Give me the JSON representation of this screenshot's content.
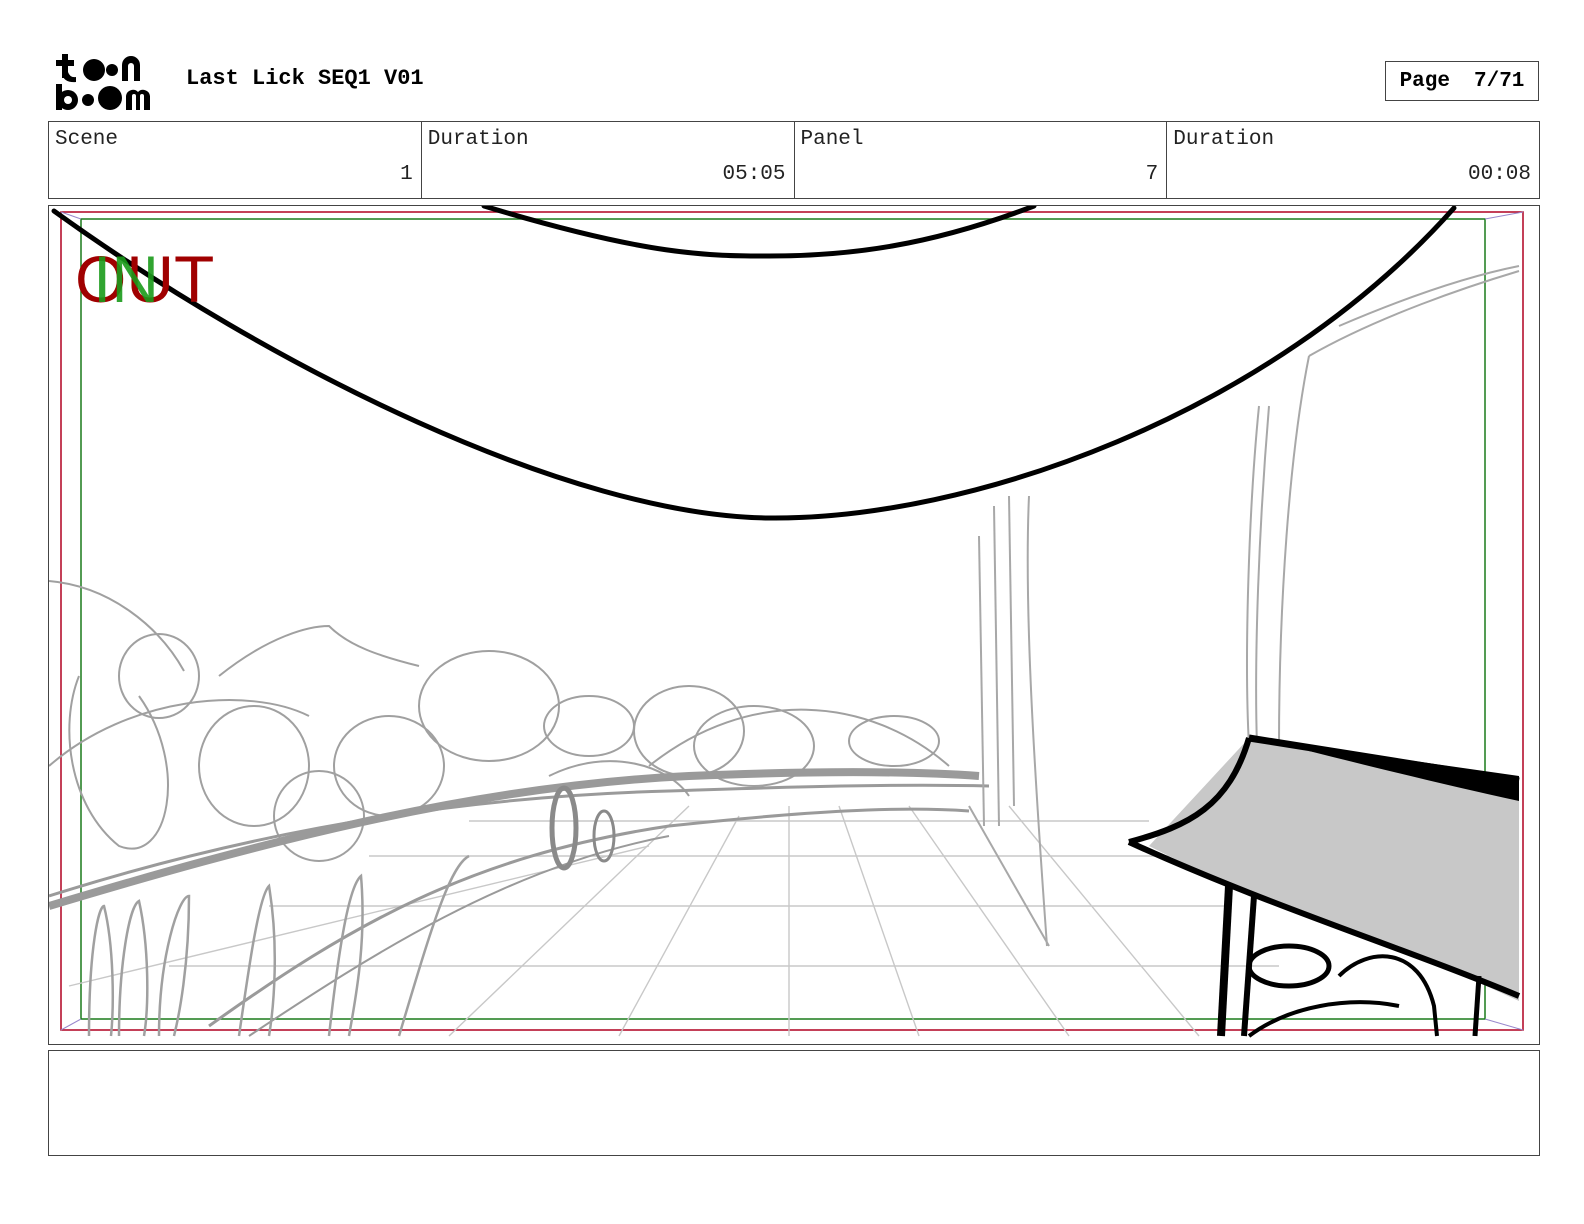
{
  "header": {
    "logo_text": "toon boom",
    "title": "Last Lick SEQ1 V01",
    "page_label": "Page",
    "page_value": "7/71"
  },
  "info": {
    "scene_label": "Scene",
    "scene_value": "1",
    "scene_duration_label": "Duration",
    "scene_duration_value": "05:05",
    "panel_label": "Panel",
    "panel_value": "7",
    "panel_duration_label": "Duration",
    "panel_duration_value": "00:08"
  },
  "frame": {
    "out_label": "OUT",
    "in_label": "IN",
    "colors": {
      "out": "#a00000",
      "in": "#1a9a1a",
      "safe_red": "#b00020",
      "safe_green": "#1a7a1a"
    }
  },
  "notes": {
    "text": ""
  }
}
